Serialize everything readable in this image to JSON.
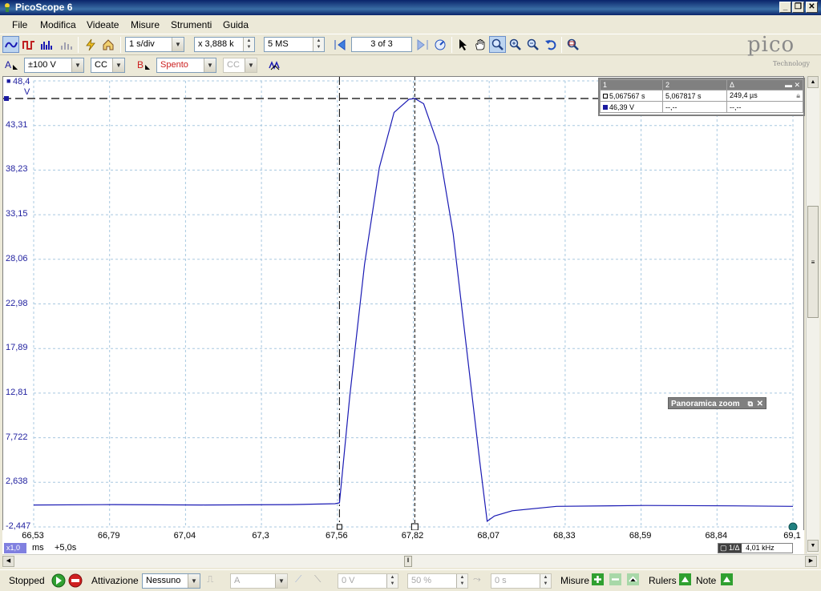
{
  "window": {
    "title": "PicoScope 6"
  },
  "menu": [
    "File",
    "Modifica",
    "Videate",
    "Misure",
    "Strumenti",
    "Guida"
  ],
  "toolbar": {
    "timebase": "1 s/div",
    "zoom_factor": "x 3,888 k",
    "samples": "5 MS",
    "buffer": "3 of 3"
  },
  "channels": {
    "a": {
      "label": "A",
      "range": "±100 V",
      "coupling": "CC",
      "color": "#1a1aa0"
    },
    "b": {
      "label": "B",
      "range": "Spento",
      "coupling": "CC",
      "color": "#cc2020"
    }
  },
  "logo": {
    "brand": "pico",
    "sub": "Technology"
  },
  "chart_data": {
    "type": "line",
    "ylabel": "V",
    "xlabel": "ms",
    "y_ticks": [
      "48,4",
      "43,31",
      "38,23",
      "33,15",
      "28,06",
      "22,98",
      "17,89",
      "12,81",
      "7,722",
      "2,638",
      "-2,447"
    ],
    "ylim": [
      -2.447,
      48.4
    ],
    "x_ticks": [
      "66,53",
      "66,79",
      "67,04",
      "67,3",
      "67,56",
      "67,82",
      "68,07",
      "68,33",
      "68,59",
      "68,84",
      "69,1"
    ],
    "xlim": [
      66.53,
      69.1
    ],
    "grid": true,
    "series": [
      {
        "color": "#1a1ab4",
        "x": [
          66.53,
          66.8,
          67.1,
          67.4,
          67.55,
          67.565,
          67.6,
          67.65,
          67.7,
          67.75,
          67.8,
          67.82,
          67.85,
          67.9,
          67.95,
          68.0,
          68.04,
          68.065,
          68.09,
          68.15,
          68.3,
          68.6,
          68.9,
          69.1
        ],
        "y": [
          0.05,
          0.1,
          0.05,
          0.1,
          0.2,
          0.3,
          12.5,
          27.5,
          38.5,
          44.8,
          46.3,
          46.39,
          45.8,
          41.0,
          31.0,
          16.5,
          5.0,
          -1.8,
          -1.2,
          -0.6,
          -0.1,
          0.0,
          -0.05,
          -0.1
        ]
      }
    ],
    "rulers": {
      "x1": 67.565,
      "x2": 67.82,
      "y": 46.39
    }
  },
  "measurements": {
    "headers": [
      "1",
      "2",
      "Δ"
    ],
    "time_row": [
      "5,067567 s",
      "5,067817 s",
      "249,4 µs"
    ],
    "volt_row": [
      "46,39 V",
      "--,--",
      "--,--"
    ]
  },
  "zoom_overview": {
    "label": "Panoramica zoom"
  },
  "scope_footer": {
    "xscale": "x1,0",
    "unit": "ms",
    "offset": "+5,0s",
    "freq_label": "1/Δ",
    "freq": "4,01 kHz"
  },
  "status": {
    "state": "Stopped",
    "trigger_label": "Attivazione",
    "trigger_mode": "Nessuno",
    "trigger_channel": "A",
    "trigger_level": "0 V",
    "pretrigger": "50 %",
    "delay": "0 s",
    "measures_label": "Misure",
    "rulers_label": "Rulers",
    "notes_label": "Note"
  }
}
